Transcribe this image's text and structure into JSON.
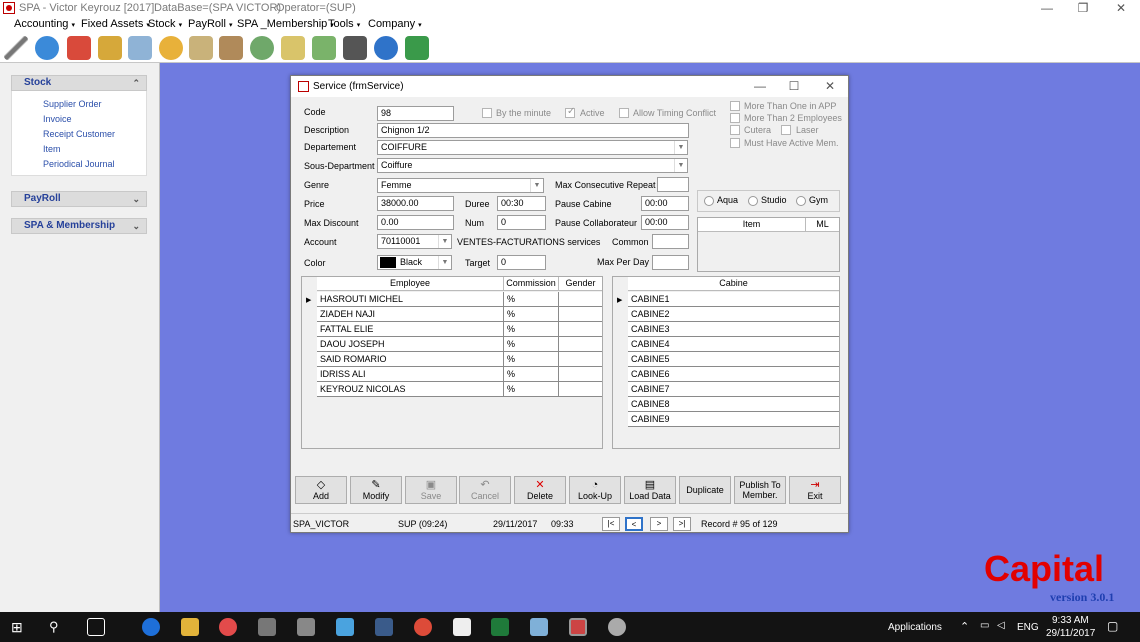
{
  "app": {
    "title_parts": [
      "SPA - Victor Keyrouz [2017]",
      "DataBase=(SPA VICTOR)",
      "Operator=(SUP)"
    ],
    "window_buttons": [
      "—",
      "❐",
      "✕"
    ]
  },
  "menu": [
    "Accounting",
    "Fixed Assets",
    "Stock",
    "PayRoll",
    "SPA _Membership",
    "Tools",
    "Company"
  ],
  "sidebar": {
    "stock": {
      "title": "Stock",
      "chevron": "⌃",
      "items": [
        "Supplier Order",
        "Invoice",
        "Receipt Customer",
        "Item",
        "Periodical Journal"
      ]
    },
    "payroll": {
      "title": "PayRoll",
      "chevron": "⌄"
    },
    "spa": {
      "title": "SPA & Membership",
      "chevron": "⌄"
    }
  },
  "form": {
    "title": "Service  (frmService)",
    "code": {
      "label": "Code",
      "value": "98"
    },
    "by_minute": "By the minute",
    "active": "Active",
    "timing_conflict": "Allow Timing Conflict",
    "options": [
      "More Than One in APP",
      "More Than 2 Employees",
      "Cutera",
      "Laser",
      "Must Have Active Mem."
    ],
    "description": {
      "label": "Description",
      "value": "Chignon 1/2"
    },
    "department": {
      "label": "Departement",
      "value": "COIFFURE"
    },
    "sous_department": {
      "label": "Sous-Department",
      "value": "Coiffure"
    },
    "genre": {
      "label": "Genre",
      "value": "Femme"
    },
    "max_consecutive": {
      "label": "Max Consecutive Repeat",
      "value": ""
    },
    "price": {
      "label": "Price",
      "value": "38000.00"
    },
    "duree": {
      "label": "Duree",
      "value": "00:30"
    },
    "pause_cabine": {
      "label": "Pause Cabine",
      "value": "00:00"
    },
    "max_discount": {
      "label": "Max Discount",
      "value": "0.00"
    },
    "num": {
      "label": "Num",
      "value": "0"
    },
    "pause_collab": {
      "label": "Pause Collaborateur",
      "value": "00:00"
    },
    "account": {
      "label": "Account",
      "value": "70110001",
      "desc": "VENTES-FACTURATIONS services"
    },
    "common": {
      "label": "Common",
      "value": ""
    },
    "color": {
      "label": "Color",
      "value": "Black"
    },
    "target": {
      "label": "Target",
      "value": "0"
    },
    "max_per_day": {
      "label": "Max Per Day",
      "value": ""
    },
    "radios": [
      "Aqua",
      "Studio",
      "Gym"
    ],
    "item_grid": {
      "col_item": "Item",
      "col_ml": "ML"
    },
    "employees": {
      "headers": [
        "Employee",
        "Commission",
        "Gender"
      ],
      "rows": [
        {
          "name": "HASROUTI MICHEL",
          "commission": "%"
        },
        {
          "name": "ZIADEH NAJI",
          "commission": "%"
        },
        {
          "name": "FATTAL ELIE",
          "commission": "%"
        },
        {
          "name": "DAOU JOSEPH",
          "commission": "%"
        },
        {
          "name": "SAID ROMARIO",
          "commission": "%"
        },
        {
          "name": "IDRISS ALI",
          "commission": "%"
        },
        {
          "name": "KEYROUZ NICOLAS",
          "commission": "%"
        }
      ]
    },
    "cabines": {
      "header": "Cabine",
      "rows": [
        "CABINE1",
        "CABINE2",
        "CABINE3",
        "CABINE4",
        "CABINE5",
        "CABINE6",
        "CABINE7",
        "CABINE8",
        "CABINE9"
      ]
    },
    "buttons": [
      {
        "label": "Add",
        "icon": "◇",
        "enabled": true
      },
      {
        "label": "Modify",
        "icon": "✎",
        "enabled": true
      },
      {
        "label": "Save",
        "icon": "▣",
        "enabled": false
      },
      {
        "label": "Cancel",
        "icon": "↶",
        "enabled": false
      },
      {
        "label": "Delete",
        "icon": "✕",
        "enabled": true
      },
      {
        "label": "Look-Up",
        "icon": "◔",
        "enabled": true
      },
      {
        "label": "Load Data",
        "icon": "▤",
        "enabled": true
      },
      {
        "label": "Duplicate",
        "icon": "",
        "enabled": true
      },
      {
        "label": "Publish To Member.",
        "icon": "",
        "enabled": true
      },
      {
        "label": "Exit",
        "icon": "⇥",
        "enabled": true
      }
    ],
    "status": {
      "db": "SPA_VICTOR",
      "user": "SUP (09:24)",
      "date": "29/11/2017",
      "time": "09:33",
      "nav": [
        "|<",
        "<",
        ">",
        ">|"
      ],
      "record": "Record #  95 of 129"
    }
  },
  "brand": {
    "name": "Capital",
    "version": "version 3.0.1"
  },
  "taskbar": {
    "apps_label": "Applications",
    "lang": "ENG",
    "time": "9:33 AM",
    "date": "29/11/2017"
  }
}
